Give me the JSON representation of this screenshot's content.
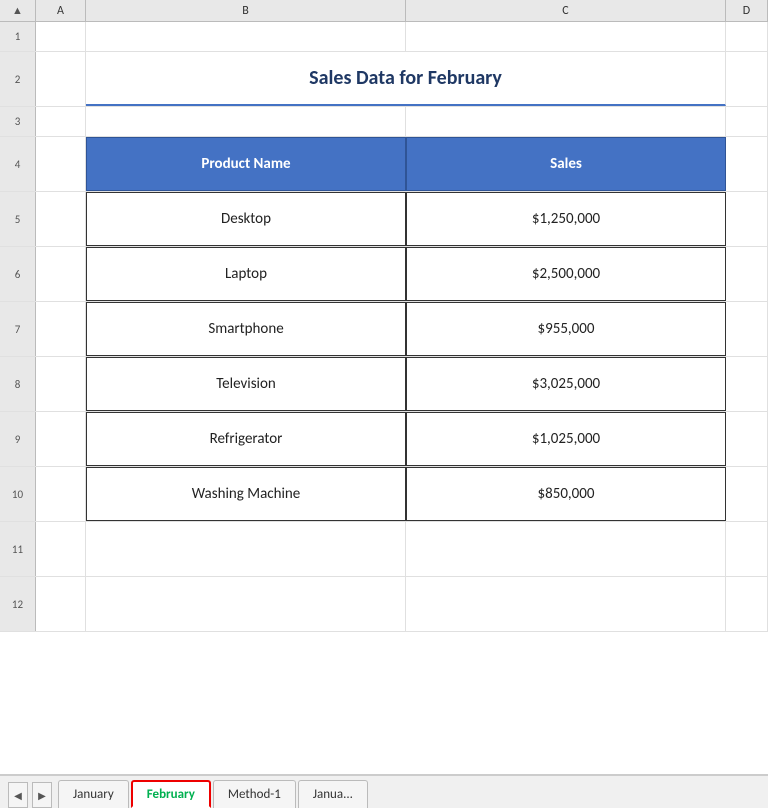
{
  "columns": {
    "headers": [
      "▲",
      "A",
      "B",
      "C",
      "D"
    ]
  },
  "rows": [
    {
      "num": 1
    },
    {
      "num": 2,
      "b": "Sales Data for February"
    },
    {
      "num": 3
    },
    {
      "num": 4,
      "b": "Product Name",
      "c": "Sales",
      "header": true
    },
    {
      "num": 5,
      "b": "Desktop",
      "c": "$1,250,000"
    },
    {
      "num": 6,
      "b": "Laptop",
      "c": "$2,500,000"
    },
    {
      "num": 7,
      "b": "Smartphone",
      "c": "$955,000"
    },
    {
      "num": 8,
      "b": "Television",
      "c": "$3,025,000"
    },
    {
      "num": 9,
      "b": "Refrigerator",
      "c": "$1,025,000"
    },
    {
      "num": 10,
      "b": "Washing Machine",
      "c": "$850,000"
    },
    {
      "num": 11
    },
    {
      "num": 12
    }
  ],
  "tabs": [
    {
      "label": "January",
      "active": false
    },
    {
      "label": "February",
      "active": true
    },
    {
      "label": "Method-1",
      "active": false
    },
    {
      "label": "Janua...",
      "active": false
    }
  ],
  "colors": {
    "header_bg": "#4472c4",
    "header_text": "#ffffff",
    "title_text": "#1f3864",
    "underline": "#4472c4",
    "active_tab_text": "#00b050",
    "active_tab_border": "#cc0000"
  }
}
